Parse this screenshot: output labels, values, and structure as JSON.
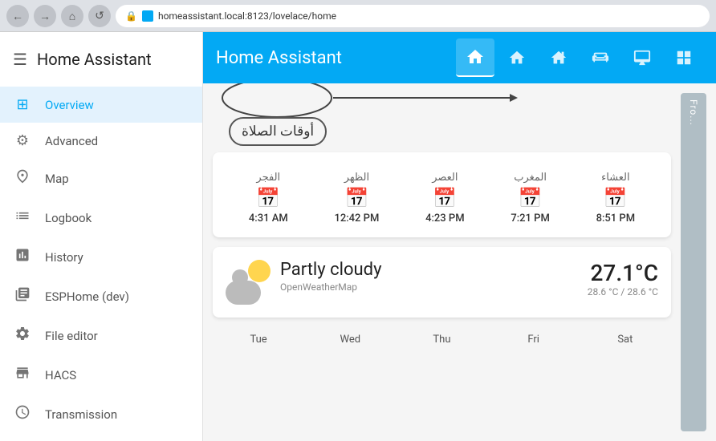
{
  "browser": {
    "back_icon": "←",
    "forward_icon": "→",
    "home_icon": "⌂",
    "refresh_icon": "↺",
    "url": "homeassistant.local:8123/lovelace/home",
    "lock_icon": "🔒",
    "favicon_color": "#03a9f4"
  },
  "sidebar": {
    "menu_icon": "☰",
    "title": "Home Assistant",
    "items": [
      {
        "id": "overview",
        "label": "Overview",
        "icon": "⊞",
        "active": true
      },
      {
        "id": "advanced",
        "label": "Advanced",
        "icon": "⚙",
        "active": false
      },
      {
        "id": "map",
        "label": "Map",
        "icon": "👤",
        "active": false
      },
      {
        "id": "logbook",
        "label": "Logbook",
        "icon": "☰",
        "active": false
      },
      {
        "id": "history",
        "label": "History",
        "icon": "📊",
        "active": false
      },
      {
        "id": "esphome",
        "label": "ESPHome (dev)",
        "icon": "🎬",
        "active": false
      },
      {
        "id": "file-editor",
        "label": "File editor",
        "icon": "🔧",
        "active": false
      },
      {
        "id": "hacs",
        "label": "HACS",
        "icon": "🏪",
        "active": false
      },
      {
        "id": "transmission",
        "label": "Transmission",
        "icon": "🕐",
        "active": false
      }
    ]
  },
  "appbar": {
    "title": "Home Assistant",
    "tabs": [
      {
        "id": "home",
        "icon": "⌂",
        "active": true
      },
      {
        "id": "star",
        "icon": "🏠",
        "active": false
      },
      {
        "id": "house",
        "icon": "🏡",
        "active": false
      },
      {
        "id": "sofa",
        "icon": "🛋",
        "active": false
      },
      {
        "id": "monitor",
        "icon": "🖥",
        "active": false
      },
      {
        "id": "grid",
        "icon": "⊞",
        "active": false
      }
    ]
  },
  "prayer_card": {
    "annotation_text": "أوقات الصلاة",
    "times": [
      {
        "name": "الفجر",
        "time": "4:31 AM"
      },
      {
        "name": "الظهر",
        "time": "12:42 PM"
      },
      {
        "name": "العصر",
        "time": "4:23 PM"
      },
      {
        "name": "المغرب",
        "time": "7:21 PM"
      },
      {
        "name": "العشاء",
        "time": "8:51 PM"
      }
    ],
    "calendar_icon": "📅"
  },
  "weather_card": {
    "condition": "Partly cloudy",
    "source": "OpenWeatherMap",
    "temperature": "27.1°C",
    "temp_range": "28.6 °C / 28.6 °C"
  },
  "forecast": {
    "days": [
      "Tue",
      "Wed",
      "Thu",
      "Fri",
      "Sat"
    ]
  },
  "right_panel": {
    "text": "Fro..."
  }
}
